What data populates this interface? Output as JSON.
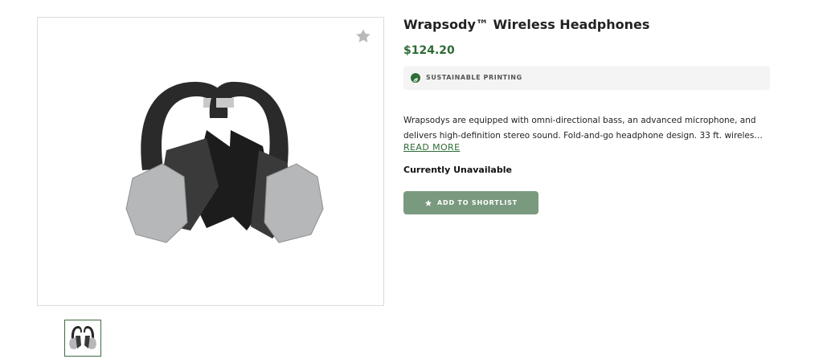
{
  "product": {
    "title": "Wrapsody™ Wireless Headphones",
    "price": "$124.20",
    "badge": {
      "icon": "leaf-icon",
      "label": "SUSTAINABLE PRINTING",
      "accent_color": "#2f6e38"
    },
    "description_lines": [
      "Wrapsodys are equipped with omni-directional bass, an advanced microphone, and",
      "delivers high-definition stereo sound. Fold-and-go headphone design. 33 ft. wireles…"
    ],
    "read_more_label": "READ MORE",
    "availability": "Currently Unavailable",
    "shortlist_button": {
      "label": "ADD TO SHORTLIST",
      "icon": "star-icon",
      "color": "#7a9a7f"
    }
  },
  "gallery": {
    "favorite_icon": "star-icon",
    "main_image": "headphones-pair-image",
    "thumbnails": [
      "headphones-thumbnail"
    ]
  },
  "colors": {
    "brand_green": "#2e6b36",
    "border": "#dcdcdc"
  }
}
